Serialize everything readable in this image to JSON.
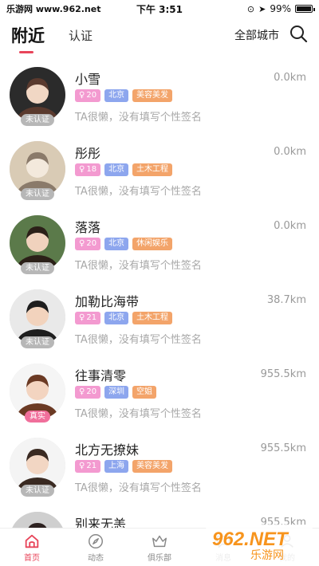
{
  "status_bar": {
    "carrier": "乐游网 www.962.net",
    "time": "下午 3:51",
    "battery": "99%",
    "battery_level": 0.99
  },
  "header": {
    "tabs": [
      {
        "label": "附近",
        "active": true
      },
      {
        "label": "认证",
        "active": false
      }
    ],
    "city_filter": "全部城市",
    "search_icon": "search-icon"
  },
  "users": [
    {
      "name": "小雪",
      "distance": "0.0km",
      "age": "20",
      "city": "北京",
      "occupation": "美容美发",
      "bio": "TA很懒，没有填写个性签名",
      "verify": "未认证",
      "verified": false
    },
    {
      "name": "彤彤",
      "distance": "0.0km",
      "age": "18",
      "city": "北京",
      "occupation": "土木工程",
      "bio": "TA很懒，没有填写个性签名",
      "verify": "未认证",
      "verified": false
    },
    {
      "name": "落落",
      "distance": "0.0km",
      "age": "20",
      "city": "北京",
      "occupation": "休闲娱乐",
      "bio": "TA很懒，没有填写个性签名",
      "verify": "未认证",
      "verified": false
    },
    {
      "name": "加勒比海带",
      "distance": "38.7km",
      "age": "21",
      "city": "北京",
      "occupation": "土木工程",
      "bio": "TA很懒，没有填写个性签名",
      "verify": "未认证",
      "verified": false
    },
    {
      "name": "往事清零",
      "distance": "955.5km",
      "age": "20",
      "city": "深圳",
      "occupation": "空姐",
      "bio": "TA很懒，没有填写个性签名",
      "verify": "真实",
      "verified": true
    },
    {
      "name": "北方无撩妹",
      "distance": "955.5km",
      "age": "21",
      "city": "上海",
      "occupation": "美容美发",
      "bio": "TA很懒，没有填写个性签名",
      "verify": "未认证",
      "verified": false
    },
    {
      "name": "别来无恙",
      "distance": "955.5km",
      "age": "",
      "city": "",
      "occupation": "",
      "bio": "",
      "verify": "",
      "verified": false
    }
  ],
  "bottom_nav": [
    {
      "label": "首页",
      "icon": "home-icon",
      "active": true
    },
    {
      "label": "动态",
      "icon": "compass-icon",
      "active": false
    },
    {
      "label": "俱乐部",
      "icon": "crown-icon",
      "active": false
    },
    {
      "label": "消息",
      "icon": "message-icon",
      "active": false
    },
    {
      "label": "我的",
      "icon": "profile-icon",
      "active": false
    }
  ],
  "watermark": {
    "logo": "962.NET",
    "text": "乐游网"
  },
  "colors": {
    "accent": "#e8455a",
    "age_tag": "#f39ad0",
    "city_tag": "#8da6ee",
    "job_tag": "#f3a46a",
    "real_badge": "#f06f9b",
    "unverified_badge": "#b7b7b7"
  }
}
